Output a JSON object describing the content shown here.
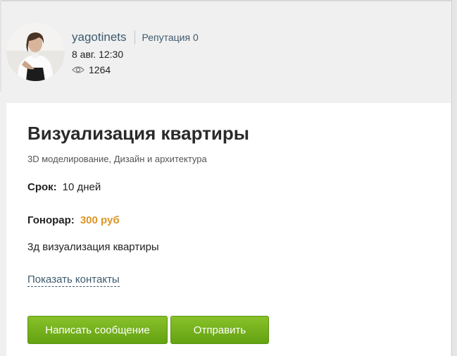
{
  "author": {
    "username": "yagotinets",
    "reputation_label": "Репутация 0",
    "date": "8 авг. 12:30",
    "views": "1264",
    "views_icon": "eye-icon"
  },
  "project": {
    "title": "Визуализация квартиры",
    "category": "3D моделирование, Дизайн и архитектура",
    "term_label": "Срок:",
    "term_value": "10 дней",
    "fee_label": "Гонорар:",
    "fee_value": "300 руб",
    "description": "3д визуализация квартиры",
    "contacts_link": "Показать контакты"
  },
  "buttons": {
    "write_message": "Написать сообщение",
    "send": "Отправить"
  },
  "colors": {
    "accent_green": "#72b11c",
    "fee_orange": "#dc9525",
    "link_blue": "#3d5a6c"
  }
}
